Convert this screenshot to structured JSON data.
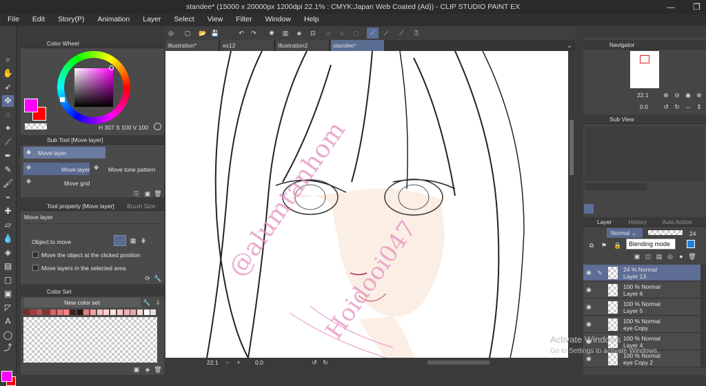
{
  "window": {
    "title": "standee* (15000 x 20000px 1200dpi 22.1% : CMYK:Japan Web Coated (Ad)) - CLIP STUDIO PAINT EX"
  },
  "menu": [
    "File",
    "Edit",
    "Story(P)",
    "Animation",
    "Layer",
    "Select",
    "View",
    "Filter",
    "Window",
    "Help"
  ],
  "color_wheel": {
    "title": "Color Wheel",
    "h": "307",
    "s": "100",
    "v": "100",
    "h_label": "H",
    "s_label": "S",
    "v_label": "V",
    "main_color": "#ff00ff",
    "sub_color": "#ff0000"
  },
  "sub_tool": {
    "title": "Sub Tool [Move layer]",
    "group": "Move layer",
    "items": [
      "Move layer",
      "Move tone pattern",
      "Move grid"
    ]
  },
  "tool_property": {
    "title": "Tool property [Move layer]",
    "tab2": "Brush Size",
    "tool_name": "Move layer",
    "object_label": "Object to move",
    "options": [
      "Move the object at the clicked position",
      "Move layers in the selected area"
    ]
  },
  "color_set": {
    "title": "Color Set",
    "set_name": "New color set",
    "swatches": [
      "#7a2a2a",
      "#b03a3a",
      "#c05050",
      "#8a3030",
      "#e06060",
      "#f07070",
      "#ff8080",
      "#402020",
      "#201818",
      "#e08080",
      "#f0a0a0",
      "#f8c0c0",
      "#ffd0d0",
      "#ffe0e0",
      "#ffc8c8",
      "#f0b0b0",
      "#e8a8a8",
      "#f8d8d8",
      "#ffffff",
      "#f0e0e0"
    ]
  },
  "tabs": [
    "Illustration*",
    "ex12",
    "Illustration2",
    "standee*"
  ],
  "status": {
    "zoom": "22.1",
    "angle": "0.0"
  },
  "navigator": {
    "title": "Navigator",
    "zoom": "22.1",
    "angle": "0.0"
  },
  "subview": {
    "title": "Sub View"
  },
  "layer_panel": {
    "tabs": [
      "Layer",
      "History",
      "Auto Action"
    ],
    "blend_mode": "Normal",
    "opacity": "24",
    "tooltip": "Blending mode",
    "layers": [
      {
        "mode": "24 % Normal",
        "name": "Layer 13",
        "selected": true
      },
      {
        "mode": "100 % Normal",
        "name": "Layer 6",
        "selected": false
      },
      {
        "mode": "100 % Normal",
        "name": "Layer 5",
        "selected": false
      },
      {
        "mode": "100 % Normal",
        "name": "eye Copy",
        "selected": false
      },
      {
        "mode": "100 % Normal",
        "name": "Layer 4",
        "selected": false
      },
      {
        "mode": "100 % Normal",
        "name": "eye Copy 2",
        "selected": false
      }
    ]
  },
  "os_watermark": {
    "line1": "Activate Windows",
    "line2": "Go to Settings to activate Windows."
  },
  "canvas_watermark": {
    "line1": "@alumtanhom",
    "line2": "Hoidooi047"
  }
}
